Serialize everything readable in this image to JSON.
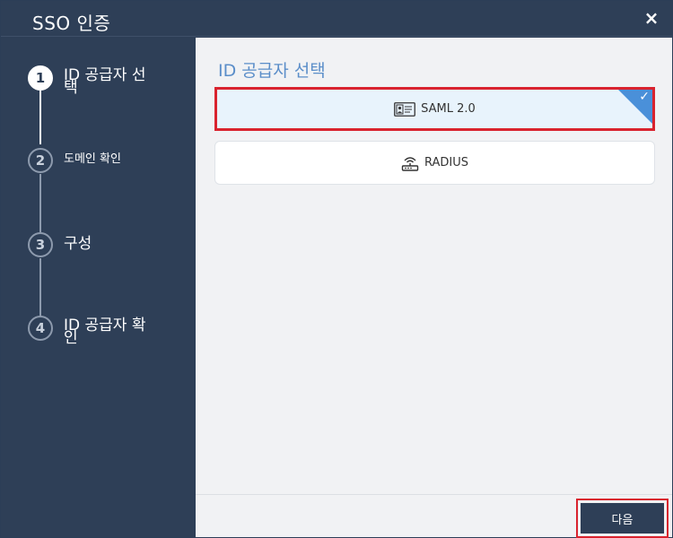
{
  "window": {
    "title": "SSO 인증",
    "close_symbol": "×"
  },
  "sidebar": {
    "steps": [
      {
        "number": "1",
        "label": "ID 공급자 선택",
        "active": true
      },
      {
        "number": "2",
        "label": "도메인 확인",
        "active": false
      },
      {
        "number": "3",
        "label": "구성",
        "active": false
      },
      {
        "number": "4",
        "label": "ID 공급자 확인",
        "active": false
      }
    ]
  },
  "main": {
    "title": "ID 공급자 선택",
    "options": [
      {
        "label": "SAML 2.0",
        "icon": "id-card-icon",
        "selected": true
      },
      {
        "label": "RADIUS",
        "icon": "router-icon",
        "selected": false
      }
    ]
  },
  "footer": {
    "next_label": "다음"
  },
  "colors": {
    "accent": "#5b8ec9",
    "dark": "#2e3f57",
    "highlight": "#d9232e",
    "check": "#4a90d9"
  }
}
